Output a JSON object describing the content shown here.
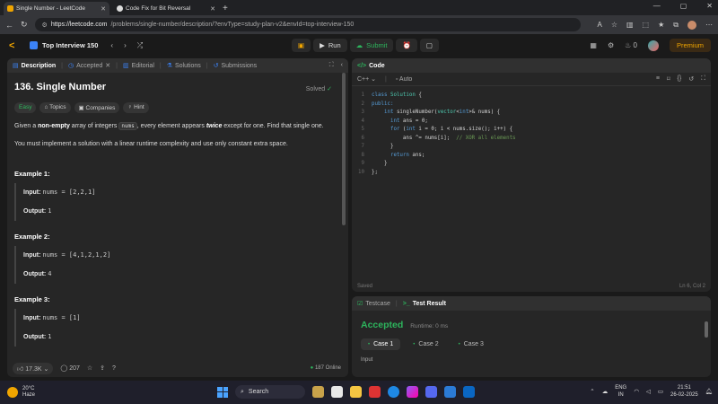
{
  "browser": {
    "tabs": [
      {
        "label": "Single Number - LeetCode",
        "active": true
      },
      {
        "label": "Code Fix for Bit Reversal",
        "active": false
      }
    ],
    "url_host": "https://leetcode.com",
    "url_path": "/problems/single-number/description/?envType=study-plan-v2&envId=top-interview-150"
  },
  "header": {
    "study_plan": "Top Interview 150",
    "run_label": "Run",
    "submit_label": "Submit",
    "streak": "0",
    "premium_label": "Premium"
  },
  "description_panel": {
    "tabs": [
      "Description",
      "Accepted",
      "Editorial",
      "Solutions",
      "Submissions"
    ],
    "title": "136. Single Number",
    "status": "Solved",
    "tags": [
      "Easy",
      "Topics",
      "Companies",
      "Hint"
    ],
    "para1_pre": "Given a ",
    "para1_bold": "non-empty",
    "para1_mid": " array of integers ",
    "para1_code": "nums",
    "para1_mid2": ", every element appears ",
    "para1_em": "twice",
    "para1_post": " except for one. Find that single one.",
    "para2": "You must implement a solution with a linear runtime complexity and use only constant extra space.",
    "examples": [
      {
        "title": "Example 1:",
        "input": "nums = [2,2,1]",
        "output": "1"
      },
      {
        "title": "Example 2:",
        "input": "nums = [4,1,2,1,2]",
        "output": "4"
      },
      {
        "title": "Example 3:",
        "input": "nums = [1]",
        "output": "1"
      }
    ],
    "input_label": "Input:",
    "output_label": "Output:",
    "likes": "17.3K",
    "comments": "207",
    "online": "187 Online"
  },
  "code_panel": {
    "title": "Code",
    "language": "C++",
    "mode": "Auto",
    "lines": [
      "class Solution {",
      "public:",
      "    int singleNumber(vector<int>& nums) {",
      "      int ans = 0;",
      "      for (int i = 0; i < nums.size(); i++) {",
      "          ans ^= nums[i];  // XOR all elements",
      "      }",
      "      return ans;",
      "    }",
      "};"
    ],
    "saved": "Saved",
    "cursor": "Ln 6, Col 2"
  },
  "test_panel": {
    "tabs": [
      "Testcase",
      "Test Result"
    ],
    "result": "Accepted",
    "runtime": "Runtime: 0 ms",
    "cases": [
      "Case 1",
      "Case 2",
      "Case 3"
    ],
    "input_label": "Input"
  },
  "taskbar": {
    "temp": "20°C",
    "weather": "Haze",
    "search": "Search",
    "lang1": "ENG",
    "lang2": "IN",
    "time": "21:51",
    "date": "26-02-2025",
    "badge": "6"
  }
}
